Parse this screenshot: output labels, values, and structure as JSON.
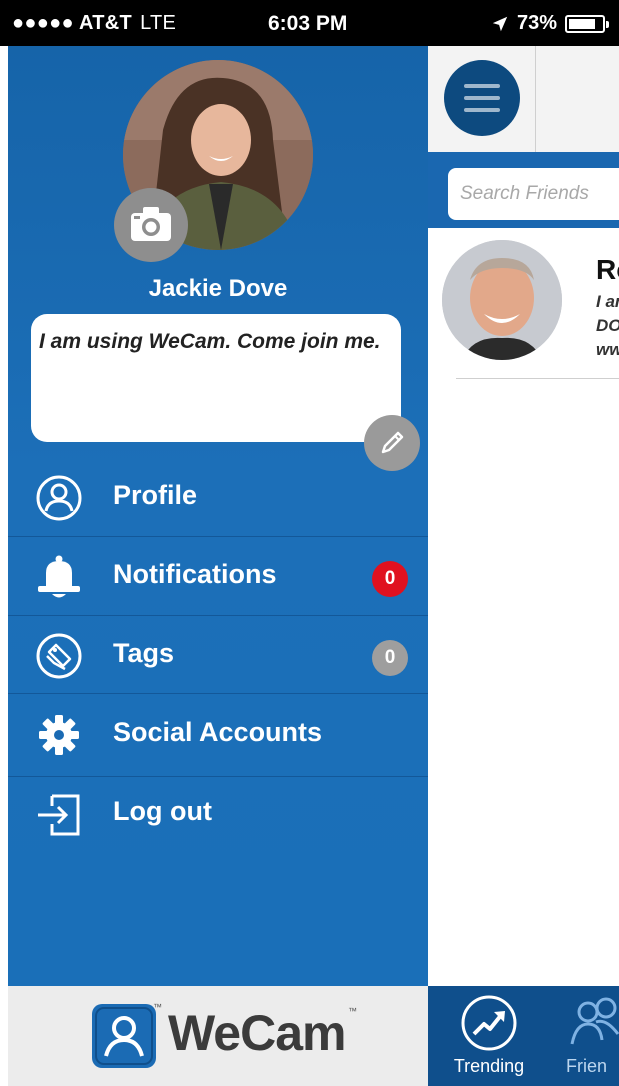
{
  "status_bar": {
    "carrier": "●●●●● AT&T",
    "network": "LTE",
    "time": "6:03 PM",
    "battery": "73%",
    "battery_level": 0.73,
    "location_icon": "location-arrow-icon"
  },
  "drawer": {
    "user_name": "Jackie Dove",
    "status_text": "I am using WeCam. Come join me.",
    "menu": [
      {
        "label": "Profile",
        "icon": "user-circle-icon"
      },
      {
        "label": "Notifications",
        "icon": "bell-icon",
        "badge": "0",
        "badge_color": "#e0111f"
      },
      {
        "label": "Tags",
        "icon": "tag-icon",
        "badge": "0",
        "badge_color": "#9e9e9e"
      },
      {
        "label": "Social Accounts",
        "icon": "gear-icon"
      },
      {
        "label": "Log out",
        "icon": "logout-icon"
      }
    ]
  },
  "footer": {
    "logo_text": "WeCam",
    "tm": "™"
  },
  "background_screen": {
    "search_placeholder": "Search Friends",
    "friend": {
      "name_partial": "Ro",
      "line1": "I am",
      "line2": "DOV",
      "line3": "ww"
    },
    "tabs": [
      {
        "label": "Trending",
        "icon": "trending-icon"
      },
      {
        "label": "Frien",
        "icon": "friends-icon"
      }
    ]
  },
  "colors": {
    "drawer_blue": "#1a6ab3",
    "nav_dark_blue": "#0f4f8c",
    "badge_red": "#e0111f"
  }
}
